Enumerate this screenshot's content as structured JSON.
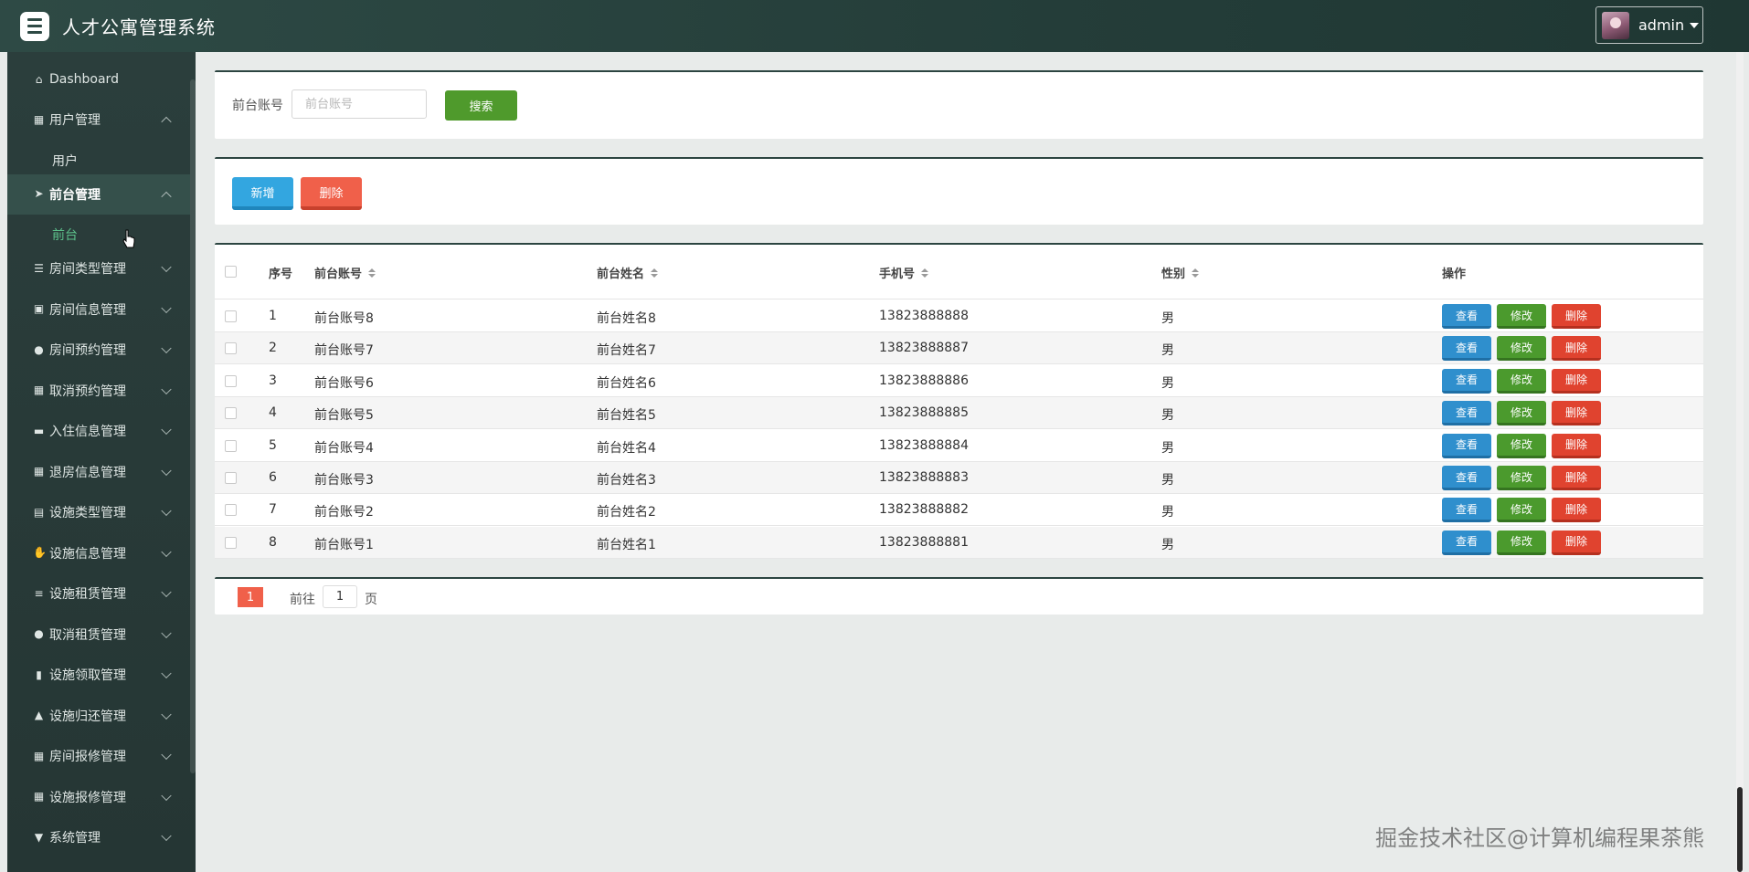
{
  "header": {
    "app_title": "人才公寓管理系统",
    "user_name": "admin"
  },
  "sidebar": {
    "items": [
      {
        "label": "Dashboard",
        "icon": "home-icon"
      },
      {
        "label": "用户管理",
        "icon": "grid-icon",
        "expanded": true
      },
      {
        "label": "用户",
        "sub": true
      },
      {
        "label": "前台管理",
        "icon": "send-icon",
        "expanded": true,
        "active": true
      },
      {
        "label": "前台",
        "sub": true,
        "current": true
      },
      {
        "label": "房间类型管理",
        "icon": "list-icon"
      },
      {
        "label": "房间信息管理",
        "icon": "image-icon"
      },
      {
        "label": "房间预约管理",
        "icon": "user-icon"
      },
      {
        "label": "取消预约管理",
        "icon": "grid-icon"
      },
      {
        "label": "入住信息管理",
        "icon": "bed-icon"
      },
      {
        "label": "退房信息管理",
        "icon": "grid-icon"
      },
      {
        "label": "设施类型管理",
        "icon": "clipboard-icon"
      },
      {
        "label": "设施信息管理",
        "icon": "thumb-icon"
      },
      {
        "label": "设施租赁管理",
        "icon": "sliders-icon"
      },
      {
        "label": "取消租赁管理",
        "icon": "bulb-icon"
      },
      {
        "label": "设施领取管理",
        "icon": "bar-chart-icon"
      },
      {
        "label": "设施归还管理",
        "icon": "stamp-icon"
      },
      {
        "label": "房间报修管理",
        "icon": "grid-icon"
      },
      {
        "label": "设施报修管理",
        "icon": "grid-icon"
      },
      {
        "label": "系统管理",
        "icon": "shield-icon"
      }
    ]
  },
  "search": {
    "label": "前台账号",
    "placeholder": "前台账号",
    "button": "搜索"
  },
  "actions": {
    "add": "新增",
    "delete": "删除"
  },
  "table": {
    "columns": [
      "序号",
      "前台账号",
      "前台姓名",
      "手机号",
      "性别",
      "操作"
    ],
    "row_actions": {
      "view": "查看",
      "edit": "修改",
      "delete": "删除"
    },
    "rows": [
      {
        "index": "1",
        "account": "前台账号8",
        "name": "前台姓名8",
        "phone": "13823888888",
        "gender": "男"
      },
      {
        "index": "2",
        "account": "前台账号7",
        "name": "前台姓名7",
        "phone": "13823888887",
        "gender": "男"
      },
      {
        "index": "3",
        "account": "前台账号6",
        "name": "前台姓名6",
        "phone": "13823888886",
        "gender": "男"
      },
      {
        "index": "4",
        "account": "前台账号5",
        "name": "前台姓名5",
        "phone": "13823888885",
        "gender": "男"
      },
      {
        "index": "5",
        "account": "前台账号4",
        "name": "前台姓名4",
        "phone": "13823888884",
        "gender": "男"
      },
      {
        "index": "6",
        "account": "前台账号3",
        "name": "前台姓名3",
        "phone": "13823888883",
        "gender": "男"
      },
      {
        "index": "7",
        "account": "前台账号2",
        "name": "前台姓名2",
        "phone": "13823888882",
        "gender": "男"
      },
      {
        "index": "8",
        "account": "前台账号1",
        "name": "前台姓名1",
        "phone": "13823888881",
        "gender": "男"
      }
    ]
  },
  "pager": {
    "current": "1",
    "goto_label": "前往",
    "goto_value": "1",
    "unit": "页"
  },
  "watermark": "掘金技术社区@计算机编程果茶熊"
}
